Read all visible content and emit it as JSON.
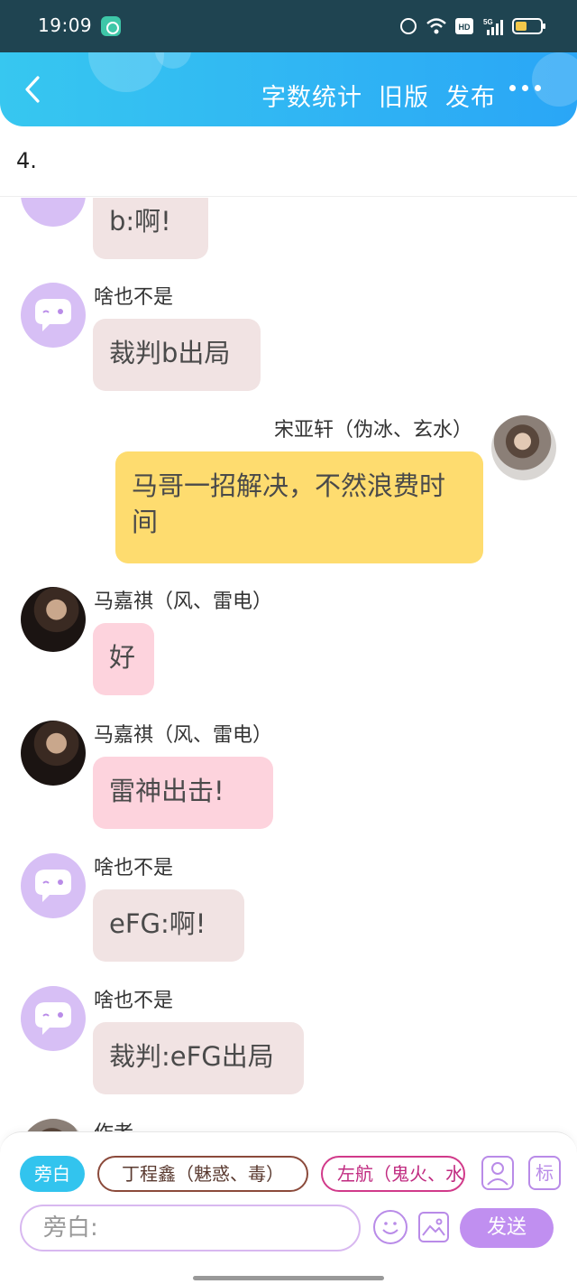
{
  "status_bar": {
    "time": "19:09",
    "icons": [
      "notification-icon",
      "alarm-icon",
      "wifi-icon",
      "hd-icon",
      "signal-5g-icon",
      "battery-icon"
    ]
  },
  "header": {
    "back_icon": "chevron-left-icon",
    "nav": [
      "字数统计",
      "旧版",
      "发布"
    ],
    "more_icon": "more-dots-icon",
    "accent": "#2aa6f6"
  },
  "chapter": {
    "title": "4."
  },
  "messages": [
    {
      "side": "left",
      "avatar": "bot-avatar",
      "sender": "",
      "text": "b:啊!",
      "style": "gray"
    },
    {
      "side": "left",
      "avatar": "bot-avatar",
      "sender": "啥也不是",
      "text": "裁判b出局",
      "style": "gray"
    },
    {
      "side": "right",
      "avatar": "photo-avatar",
      "sender": "宋亚轩（伪冰、玄水）",
      "text": "马哥一招解决，不然浪费时间",
      "style": "yellow"
    },
    {
      "side": "left",
      "avatar": "photo-avatar",
      "sender": "马嘉祺（风、雷电）",
      "text": "好",
      "style": "pink"
    },
    {
      "side": "left",
      "avatar": "photo-avatar",
      "sender": "马嘉祺（风、雷电）",
      "text": "雷神出击!",
      "style": "pink"
    },
    {
      "side": "left",
      "avatar": "bot-avatar",
      "sender": "啥也不是",
      "text": "eFG:啊!",
      "style": "gray"
    },
    {
      "side": "left",
      "avatar": "bot-avatar",
      "sender": "啥也不是",
      "text": "裁判:eFG出局",
      "style": "gray"
    },
    {
      "side": "left",
      "avatar": "photo-avatar",
      "sender": "作者",
      "text": "",
      "style": "gray"
    }
  ],
  "input": {
    "roles": [
      "旁白",
      "丁程鑫（魅惑、毒）",
      "左航（鬼火、水"
    ],
    "role_icon": "person-card-icon",
    "tag_label": "标",
    "placeholder": "旁白:",
    "emoji_icon": "emoji-icon",
    "image_icon": "image-icon",
    "send_label": "发送"
  }
}
